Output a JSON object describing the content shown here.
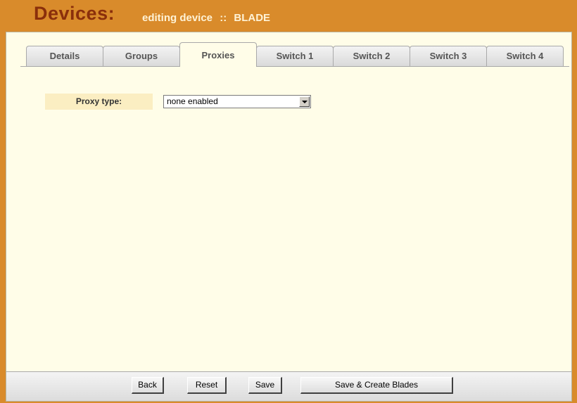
{
  "header": {
    "title": "Devices:",
    "subtitle_prefix": "editing device",
    "separator": "::",
    "device_name": "BLADE"
  },
  "tabs": [
    {
      "label": "Details",
      "active": false
    },
    {
      "label": "Groups",
      "active": false
    },
    {
      "label": "Proxies",
      "active": true
    },
    {
      "label": "Switch 1",
      "active": false
    },
    {
      "label": "Switch 2",
      "active": false
    },
    {
      "label": "Switch 3",
      "active": false
    },
    {
      "label": "Switch 4",
      "active": false
    }
  ],
  "form": {
    "proxy_type_label": "Proxy type:",
    "proxy_type_value": "none enabled"
  },
  "footer": {
    "back_label": "Back",
    "reset_label": "Reset",
    "save_label": "Save",
    "save_create_label": "Save & Create Blades"
  },
  "colors": {
    "frame": "#d98b2b",
    "title": "#8a2f0b",
    "panel_bg": "#fffde8",
    "label_bg": "#fbeec2"
  }
}
